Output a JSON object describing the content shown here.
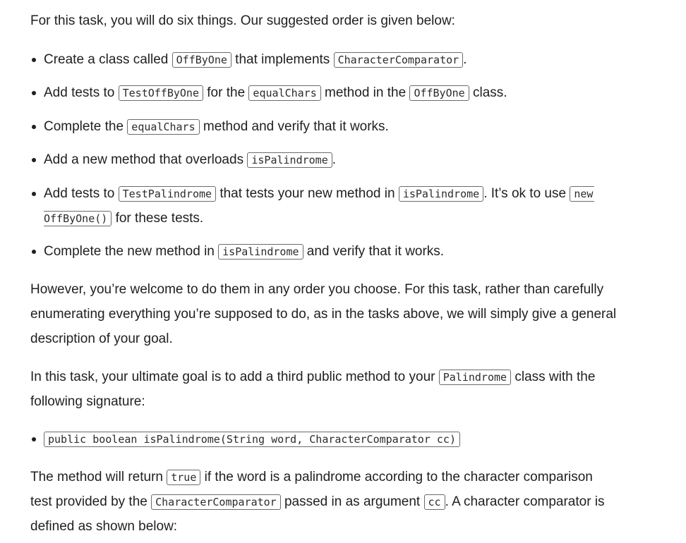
{
  "intro": "For this task, you will do six things. Our suggested order is given below:",
  "steps": {
    "s1": {
      "a": "Create a class called ",
      "c1": "OffByOne",
      "b": " that implements ",
      "c2": "CharacterComparator",
      "d": "."
    },
    "s2": {
      "a": "Add tests to ",
      "c1": "TestOffByOne",
      "b": " for the ",
      "c2": "equalChars",
      "d": " method in the ",
      "c3": "OffByOne",
      "e": " class."
    },
    "s3": {
      "a": "Complete the ",
      "c1": "equalChars",
      "b": " method and verify that it works."
    },
    "s4": {
      "a": "Add a new method that overloads ",
      "c1": "isPalindrome",
      "b": "."
    },
    "s5": {
      "a": "Add tests to ",
      "c1": "TestPalindrome",
      "b": " that tests your new method in ",
      "c2": "isPalindrome",
      "d": ". It’s ok to use ",
      "c3a": "new",
      "c3b": "OffByOne()",
      "e": " for these tests."
    },
    "s6": {
      "a": "Complete the new method in ",
      "c1": "isPalindrome",
      "b": " and verify that it works."
    }
  },
  "para_order": {
    "l1": "However, you’re welcome to do them in any order you choose. For this task, rather than carefully",
    "l2": "enumerating everything you’re supposed to do, as in the tasks above, we will simply give a general",
    "l3": "description of your goal."
  },
  "para_goal": {
    "l1a": "In this task, your ultimate goal is to add a third public method to your ",
    "l1c": "Palindrome",
    "l1b": " class with the",
    "l2": "following signature:"
  },
  "signature": "public boolean isPalindrome(String word, CharacterComparator cc)",
  "para_return": {
    "l1a": "The method will return ",
    "l1c": "true",
    "l1b": " if the word is a palindrome according to the character comparison",
    "l2a": "test provided by the ",
    "l2c1": "CharacterComparator",
    "l2b": " passed in as argument ",
    "l2c2": "cc",
    "l2d": ". A character comparator is",
    "l3": "defined as shown below:"
  }
}
